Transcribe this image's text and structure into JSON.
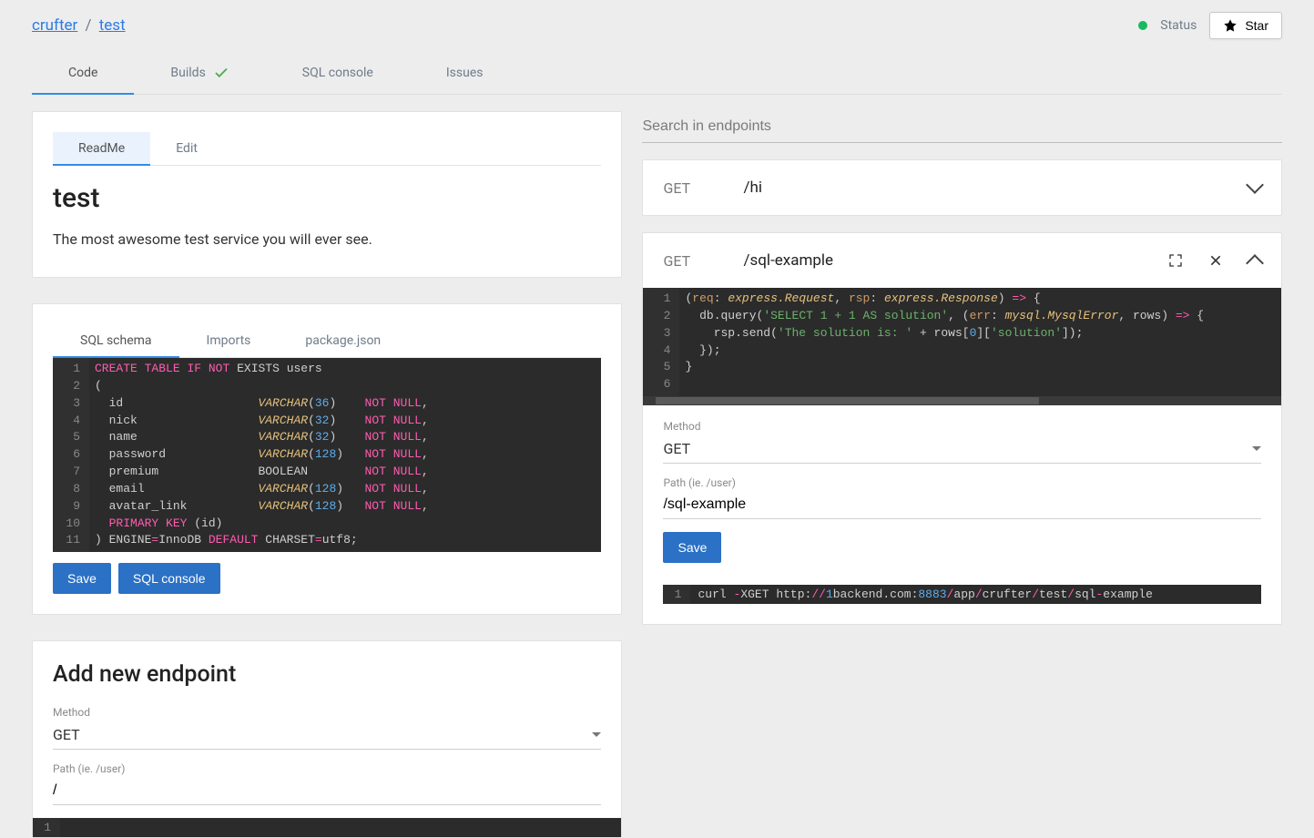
{
  "breadcrumb": {
    "owner": "crufter",
    "repo": "test"
  },
  "header": {
    "status": "Status",
    "star": "Star"
  },
  "tabs": {
    "code": "Code",
    "builds": "Builds",
    "sql_console": "SQL console",
    "issues": "Issues"
  },
  "readme": {
    "tab_readme": "ReadMe",
    "tab_edit": "Edit",
    "title": "test",
    "description": "The most awesome test service you will ever see."
  },
  "schema": {
    "tab_sql": "SQL schema",
    "tab_imports": "Imports",
    "tab_package": "package.json",
    "lines": [
      "1",
      "2",
      "3",
      "4",
      "5",
      "6",
      "7",
      "8",
      "9",
      "10",
      "11"
    ]
  },
  "buttons": {
    "save": "Save",
    "sql_console": "SQL console"
  },
  "add_endpoint": {
    "title": "Add new endpoint",
    "method_label": "Method",
    "method_value": "GET",
    "path_label": "Path (ie. /user)",
    "path_value": "/"
  },
  "search": {
    "placeholder": "Search in endpoints"
  },
  "endpoints": {
    "e0": {
      "method": "GET",
      "path": "/hi"
    },
    "e1": {
      "method": "GET",
      "path": "/sql-example",
      "code_lines": [
        "1",
        "2",
        "3",
        "4",
        "5",
        "6"
      ],
      "method_label": "Method",
      "method_value": "GET",
      "path_label": "Path (ie. /user)",
      "path_value": "/sql-example",
      "save": "Save",
      "curl_line": "1"
    }
  },
  "code_text": {
    "sql": {
      "l1a": "CREATE",
      "l1b": "TABLE",
      "l1c": "IF",
      "l1d": "NOT",
      "l1e": "EXISTS users",
      "l2": "(",
      "names": [
        "id",
        "nick",
        "name",
        "password",
        "premium",
        "email",
        "avatar_link"
      ],
      "types": [
        "VARCHAR",
        "VARCHAR",
        "VARCHAR",
        "VARCHAR",
        "BOOLEAN",
        "VARCHAR",
        "VARCHAR"
      ],
      "sizes": [
        "36",
        "32",
        "32",
        "128",
        "",
        "128",
        "128"
      ],
      "nn": "NOT",
      "null": "NULL",
      "pk": "PRIMARY",
      "key": "KEY",
      "idcol": "(id)",
      "engine": ") ENGINE",
      "eq": "=",
      "inno": "InnoDB",
      "def": "DEFAULT",
      "cs": "CHARSET",
      "utf": "utf8;"
    },
    "js": {
      "l1": "(",
      "req": "req",
      "c": ": ",
      "t1": "express.Request",
      "cm": ", ",
      "rsp": "rsp",
      "t2": "express.Response",
      "ar": ") ",
      "arr": "=>",
      "ob": " {",
      "l2a": "  db.query(",
      "s1": "'SELECT 1 + 1 AS solution'",
      "l2b": ", (",
      "err": "err",
      "t3": "mysql.MysqlError",
      "rows": ", rows) ",
      "ob2": " {",
      "l3a": "    rsp.send(",
      "s2": "'The solution is: '",
      "plus": " + rows[",
      "zero": "0",
      "plus2": "][",
      "s3": "'solution'",
      "end3": "]);",
      "l4": "  });",
      "l5": "}"
    },
    "curl": {
      "cmd": "curl ",
      "dash": "-",
      "xget": "XGET http:",
      "sl": "//",
      "one": "1",
      "host": "backend.com:",
      "port": "8883",
      "p1": "/",
      "app": "app",
      "own": "crufter",
      "repo": "test",
      "ep": "sql",
      "dash2": "-",
      "ex": "example"
    }
  }
}
